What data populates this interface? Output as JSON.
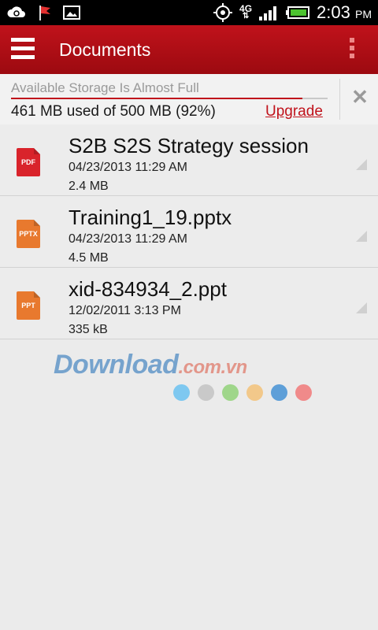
{
  "status_bar": {
    "time": "2:03",
    "ampm": "PM",
    "network": "4G",
    "icons": [
      "sync-cloud-icon",
      "red-flag-icon",
      "image-icon",
      "gps-icon",
      "network-4g-icon",
      "signal-icon",
      "battery-icon"
    ]
  },
  "action_bar": {
    "title": "Documents",
    "menu_icon": "hamburger-menu-icon",
    "overflow_icon": "overflow-menu-icon",
    "color": "#c0121b"
  },
  "storage_banner": {
    "title": "Available Storage Is Almost Full",
    "usage": "461 MB used of 500 MB (92%)",
    "used_fraction": 0.92,
    "upgrade_label": "Upgrade",
    "close_icon": "close-icon",
    "close_glyph": "✕"
  },
  "files": [
    {
      "name": "S2B  S2S Strategy session",
      "date": "04/23/2013 11:29 AM",
      "size": "2.4 MB",
      "type_label": "PDF",
      "icon_color": "#d9232b"
    },
    {
      "name": "Training1_19.pptx",
      "date": "04/23/2013 11:29 AM",
      "size": "4.5 MB",
      "type_label": "PPTX",
      "icon_color": "#e8792e"
    },
    {
      "name": "xid-834934_2.ppt",
      "date": "12/02/2011 3:13 PM",
      "size": "335 kB",
      "type_label": "PPT",
      "icon_color": "#e8792e"
    }
  ],
  "watermark": {
    "brand": "Download",
    "suffix": ".com.vn",
    "dot_colors": [
      "#7ec8f0",
      "#c9c9c9",
      "#9fd68a",
      "#f2c88a",
      "#5e9fd8",
      "#f08a8a"
    ]
  }
}
